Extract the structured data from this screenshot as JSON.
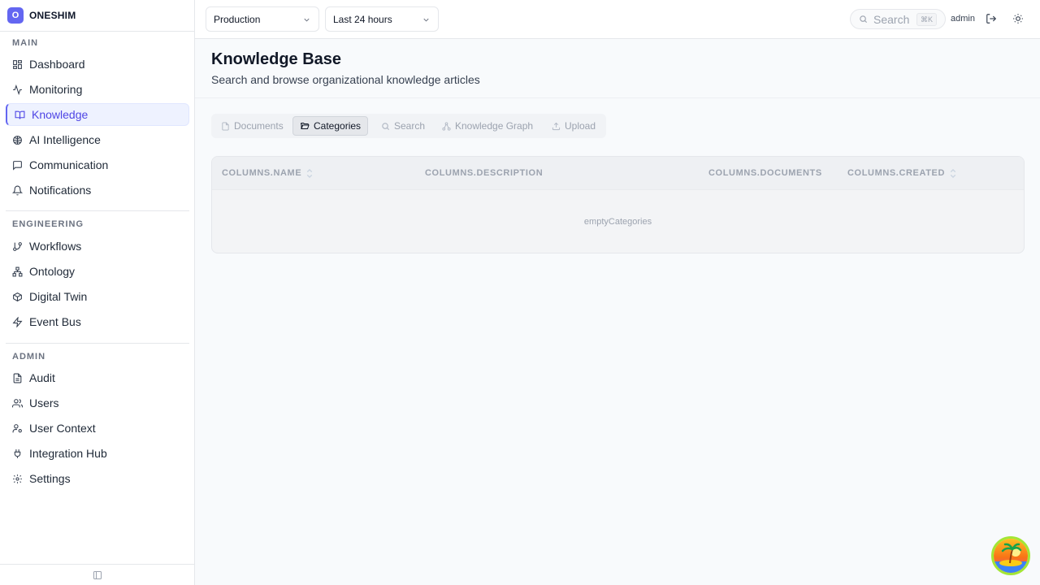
{
  "brand": {
    "logo_letter": "O",
    "name": "ONESHIM"
  },
  "sidebar": {
    "sections": [
      {
        "title": "MAIN",
        "items": [
          {
            "label": "Dashboard",
            "icon": "grid-icon"
          },
          {
            "label": "Monitoring",
            "icon": "activity-icon"
          },
          {
            "label": "Knowledge",
            "icon": "book-open-icon",
            "active": true
          },
          {
            "label": "AI Intelligence",
            "icon": "brain-icon"
          },
          {
            "label": "Communication",
            "icon": "message-icon"
          },
          {
            "label": "Notifications",
            "icon": "bell-icon"
          }
        ]
      },
      {
        "title": "ENGINEERING",
        "items": [
          {
            "label": "Workflows",
            "icon": "git-branch-icon"
          },
          {
            "label": "Ontology",
            "icon": "network-icon"
          },
          {
            "label": "Digital Twin",
            "icon": "cube-icon"
          },
          {
            "label": "Event Bus",
            "icon": "zap-icon"
          }
        ]
      },
      {
        "title": "ADMIN",
        "items": [
          {
            "label": "Audit",
            "icon": "file-text-icon"
          },
          {
            "label": "Users",
            "icon": "users-icon"
          },
          {
            "label": "User Context",
            "icon": "user-context-icon"
          },
          {
            "label": "Integration Hub",
            "icon": "plug-icon"
          },
          {
            "label": "Settings",
            "icon": "gear-icon"
          }
        ]
      }
    ]
  },
  "topbar": {
    "environment": "Production",
    "time_range": "Last 24 hours",
    "search_placeholder": "Search",
    "search_shortcut": "⌘K",
    "user": "admin"
  },
  "page": {
    "title": "Knowledge Base",
    "subtitle": "Search and browse organizational knowledge articles"
  },
  "tabs": [
    {
      "label": "Documents",
      "icon": "file-icon"
    },
    {
      "label": "Categories",
      "icon": "folder-open-icon",
      "active": true
    },
    {
      "label": "Search",
      "icon": "search-icon"
    },
    {
      "label": "Knowledge Graph",
      "icon": "graph-icon"
    },
    {
      "label": "Upload",
      "icon": "upload-icon"
    }
  ],
  "table": {
    "columns": [
      {
        "label": "COLUMNS.NAME",
        "sortable": true
      },
      {
        "label": "COLUMNS.DESCRIPTION",
        "sortable": false
      },
      {
        "label": "COLUMNS.DOCUMENTS",
        "sortable": false
      },
      {
        "label": "COLUMNS.CREATED",
        "sortable": true
      }
    ],
    "empty_message": "emptyCategories"
  },
  "colors": {
    "accent": "#6366f1",
    "active_bg": "#eef2ff"
  }
}
